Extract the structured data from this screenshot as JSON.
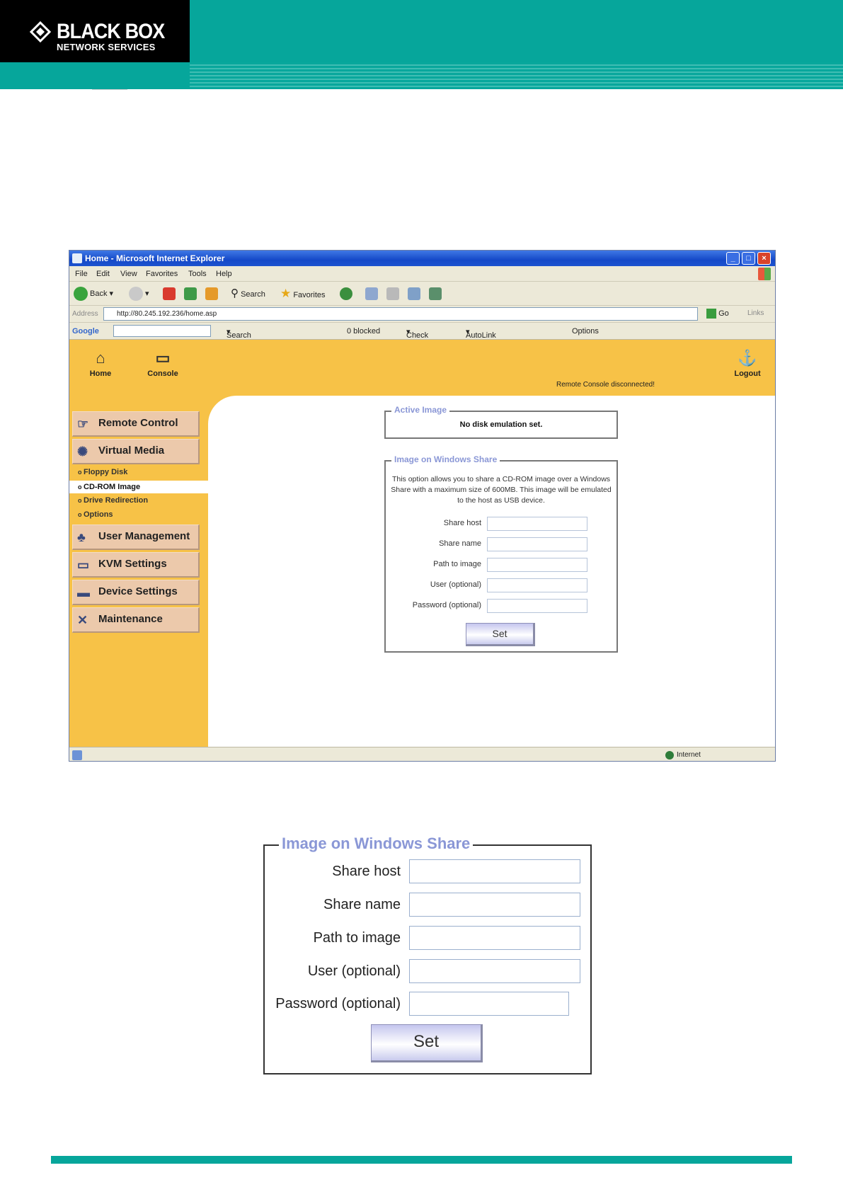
{
  "brand": {
    "logo_main": "BLACK BOX",
    "logo_sub": "NETWORK SERVICES",
    "teal": "#06a69b"
  },
  "browser": {
    "title": "Home - Microsoft Internet Explorer",
    "menu": [
      "File",
      "Edit",
      "View",
      "Favorites",
      "Tools",
      "Help"
    ],
    "toolbar": {
      "back": "Back",
      "search": "Search",
      "favorites": "Favorites"
    },
    "address": {
      "label": "Address",
      "url": "http://80.245.192.236/home.asp",
      "go": "Go",
      "links": "Links"
    },
    "google_bar": {
      "logo": "Google",
      "search": "Search",
      "blocked": "0 blocked",
      "check": "Check",
      "autolink": "AutoLink",
      "options": "Options"
    },
    "status": {
      "zone": "Internet"
    }
  },
  "app": {
    "nav": {
      "home": "Home",
      "console": "Console",
      "logout": "Logout"
    },
    "remote_status": "Remote Console disconnected!",
    "sidebar": {
      "items": [
        {
          "label": "Remote Control",
          "icon": "remote-control-icon"
        },
        {
          "label": "Virtual Media",
          "icon": "virtual-media-icon"
        },
        {
          "label": "User Management",
          "icon": "user-management-icon"
        },
        {
          "label": "KVM Settings",
          "icon": "kvm-settings-icon"
        },
        {
          "label": "Device Settings",
          "icon": "device-settings-icon"
        },
        {
          "label": "Maintenance",
          "icon": "maintenance-icon"
        }
      ],
      "submenu": [
        "Floppy Disk",
        "CD-ROM Image",
        "Drive Redirection",
        "Options"
      ],
      "active_submenu": "CD-ROM Image"
    },
    "active_image": {
      "legend": "Active Image",
      "status": "No disk emulation set."
    },
    "windows_share": {
      "legend": "Image on Windows Share",
      "description": "This option allows you to share a CD-ROM image over a Windows Share with a maximum size of 600MB. This image will be emulated to the host as USB device.",
      "fields": {
        "share_host": {
          "label": "Share host",
          "value": ""
        },
        "share_name": {
          "label": "Share name",
          "value": ""
        },
        "path": {
          "label": "Path to image",
          "value": ""
        },
        "user": {
          "label": "User (optional)",
          "value": ""
        },
        "password": {
          "label": "Password (optional)",
          "value": ""
        }
      },
      "set_button": "Set"
    },
    "colors": {
      "band": "#f7c247",
      "menu_button": "#ecc9ab",
      "legend": "#8a97d6"
    }
  }
}
